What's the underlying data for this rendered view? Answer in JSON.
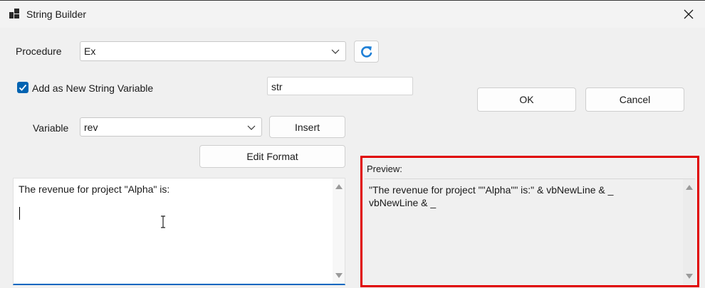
{
  "window": {
    "title": "String Builder"
  },
  "procedure": {
    "label": "Procedure",
    "value": "Ex"
  },
  "add_variable": {
    "label": "Add as New String Variable",
    "checked": true,
    "name_value": "str"
  },
  "variable": {
    "label": "Variable",
    "value": "rev",
    "insert_label": "Insert"
  },
  "edit_format_label": "Edit Format",
  "ok_label": "OK",
  "cancel_label": "Cancel",
  "editor": {
    "text": "The revenue for project \"Alpha\" is:"
  },
  "preview": {
    "label": "Preview:",
    "text": "\"The revenue for project \"\"Alpha\"\" is:\" & vbNewLine & _\nvbNewLine & _"
  },
  "colors": {
    "accent": "#0063b1",
    "highlight": "#e00000"
  }
}
